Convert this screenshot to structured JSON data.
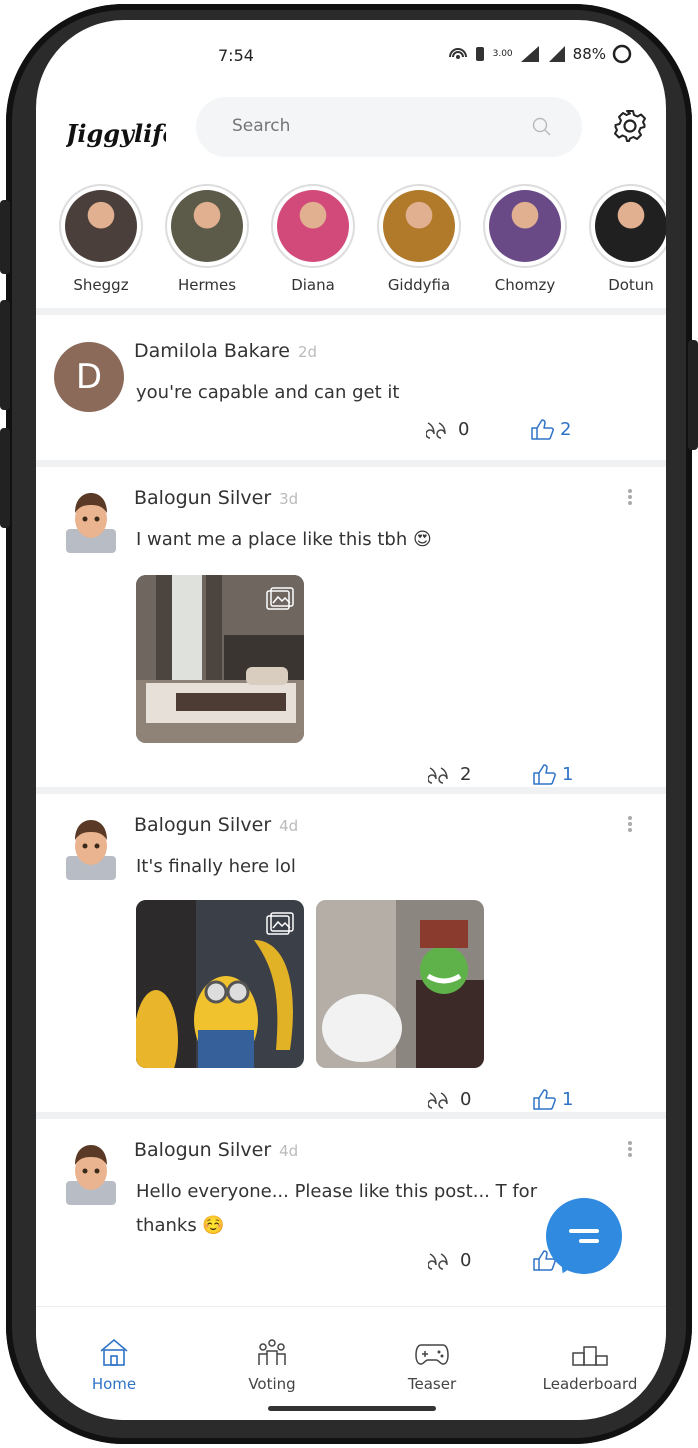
{
  "status_bar": {
    "time": "7:54",
    "speed": "3.00",
    "battery": "88%"
  },
  "app": {
    "logo_text": "Jiggylife"
  },
  "search": {
    "placeholder": "Search"
  },
  "stories": [
    {
      "name": "Sheggz",
      "color": "#4a3f3a"
    },
    {
      "name": "Hermes",
      "color": "#5c5a48"
    },
    {
      "name": "Diana",
      "color": "#d24a7a"
    },
    {
      "name": "Giddyfia",
      "color": "#b07a2a"
    },
    {
      "name": "Chomzy",
      "color": "#6a4a86"
    },
    {
      "name": "Dotun",
      "color": "#202020"
    }
  ],
  "posts": [
    {
      "author": "Damilola Bakare",
      "ago": "2d",
      "text": "you're capable and can get it",
      "comments": "0",
      "likes": "2",
      "avatar_letter": "D"
    },
    {
      "author": "Balogun Silver",
      "ago": "3d",
      "text": "I want me a place like this tbh 😍",
      "comments": "2",
      "likes": "1"
    },
    {
      "author": "Balogun Silver",
      "ago": "4d",
      "text": "It's finally here lol",
      "comments": "0",
      "likes": "1"
    },
    {
      "author": "Balogun Silver",
      "ago": "4d",
      "text": "Hello everyone... Please like this post... T for thanks ☺️",
      "comments": "0",
      "likes": ""
    }
  ],
  "nav": {
    "tabs": [
      {
        "label": "Home",
        "icon": "home-icon",
        "active": true
      },
      {
        "label": "Voting",
        "icon": "voting-icon"
      },
      {
        "label": "Teaser",
        "icon": "gamepad-icon"
      },
      {
        "label": "Leaderboard",
        "icon": "podium-icon"
      }
    ]
  },
  "colors": {
    "accent": "#2f73c7",
    "fab": "#2f8ae0"
  }
}
